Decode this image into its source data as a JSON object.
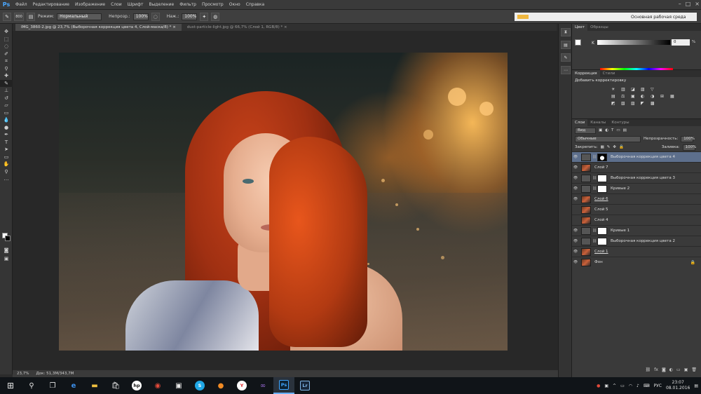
{
  "app": {
    "logo": "Ps",
    "menu": [
      "Файл",
      "Редактирование",
      "Изображение",
      "Слои",
      "Шрифт",
      "Выделение",
      "Фильтр",
      "Просмотр",
      "Окно",
      "Справка"
    ]
  },
  "options_bar": {
    "brush_size": "800",
    "mode_label": "Режим:",
    "mode_value": "Нормальный",
    "opacity_label": "Непрозр.:",
    "opacity_value": "100%",
    "flow_label": "Наж.:",
    "flow_value": "100%",
    "workspace": "Основная рабочая среда"
  },
  "doc_tabs": [
    {
      "label": "IMG_3860-2.jpg @ 23,7% (Выборочная коррекция цвета 4, Слой-маска/8) *",
      "active": true
    },
    {
      "label": "dust-particle-light.jpg @ 66,7% (Слой 1, RGB/8) *",
      "active": false
    }
  ],
  "status_bar": {
    "zoom": "23,7%",
    "doc_size": "Док: 51,3M/343,7M"
  },
  "color_panel": {
    "tabs": [
      "Цвет",
      "Образцы"
    ],
    "channel_label": "K",
    "channel_value": "0",
    "channel_unit": "%"
  },
  "adjustments_panel": {
    "tabs": [
      "Коррекция",
      "Стили"
    ],
    "title": "Добавить корректировку",
    "icons_row1": [
      "☀",
      "▥",
      "◪",
      "▨",
      "▽"
    ],
    "icons_row2": [
      "▤",
      "⚖",
      "▣",
      "◐",
      "◑",
      "⊞",
      "▦"
    ],
    "icons_row3": [
      "◩",
      "▧",
      "▨",
      "◤",
      "▩"
    ]
  },
  "layers_panel": {
    "tabs": [
      "Слои",
      "Каналы",
      "Контуры"
    ],
    "kind_label": "Вид",
    "blend_mode": "Обычные",
    "opacity_label": "Непрозрачность:",
    "opacity_value": "100%",
    "lock_label": "Закрепить:",
    "fill_label": "Заливка:",
    "fill_value": "100%",
    "layers": [
      {
        "name": "Выборочная коррекция цвета 4",
        "type": "adj",
        "mask": "mask-dark",
        "visible": true,
        "active": true,
        "underline": false
      },
      {
        "name": "Слой 7",
        "type": "img",
        "mask": "",
        "visible": true,
        "active": false,
        "underline": false
      },
      {
        "name": "Выборочная коррекция цвета 3",
        "type": "adj",
        "mask": "mask",
        "visible": true,
        "active": false,
        "underline": false
      },
      {
        "name": "Кривые 2",
        "type": "adj",
        "mask": "mask",
        "visible": true,
        "active": false,
        "underline": false
      },
      {
        "name": "Слой 6",
        "type": "img",
        "mask": "",
        "visible": true,
        "active": false,
        "underline": true
      },
      {
        "name": "Слой 5",
        "type": "img",
        "mask": "",
        "visible": false,
        "active": false,
        "underline": false
      },
      {
        "name": "Слой 4",
        "type": "img",
        "mask": "",
        "visible": false,
        "active": false,
        "underline": false
      },
      {
        "name": "Кривые 1",
        "type": "adj",
        "mask": "mask",
        "visible": true,
        "active": false,
        "underline": false
      },
      {
        "name": "Выборочная коррекция цвета 2",
        "type": "adj",
        "mask": "mask",
        "visible": true,
        "active": false,
        "underline": false
      },
      {
        "name": "Слой 1",
        "type": "img",
        "mask": "",
        "visible": true,
        "active": false,
        "underline": true
      },
      {
        "name": "Фон",
        "type": "img",
        "mask": "",
        "visible": true,
        "active": false,
        "underline": false,
        "locked": true
      }
    ]
  },
  "taskbar": {
    "language": "РУС",
    "time": "23:07",
    "date": "08.01.2016"
  },
  "colors": {
    "accent": "#4aa7ff",
    "active_layer": "#5d6f8c"
  }
}
